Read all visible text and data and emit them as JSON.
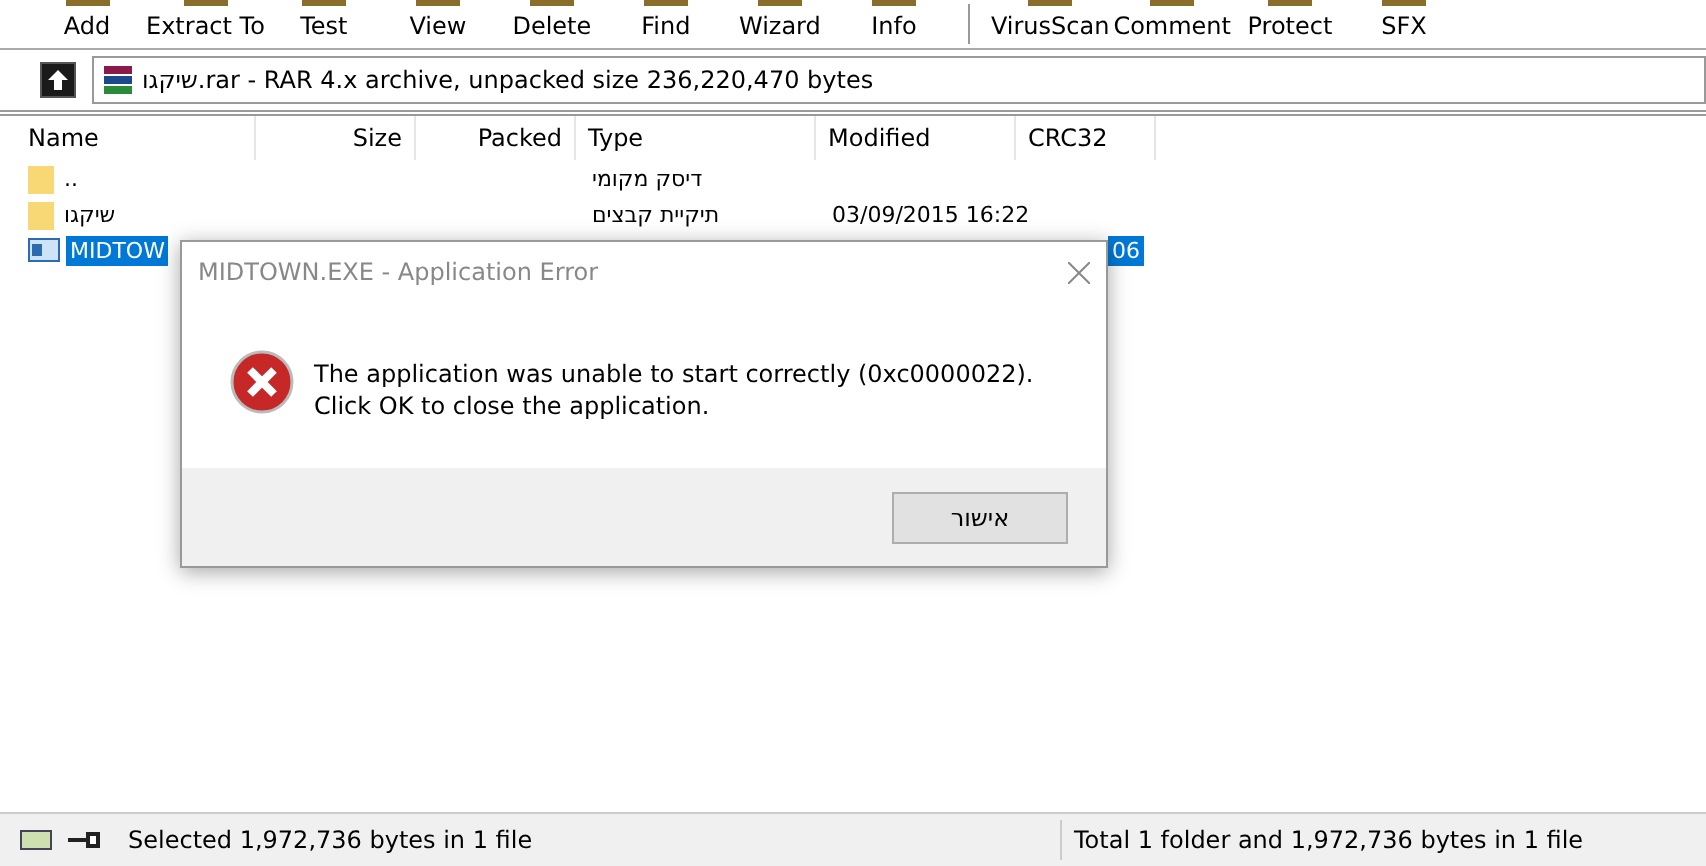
{
  "toolbar": {
    "buttons": [
      {
        "label": "Add"
      },
      {
        "label": "Extract To"
      },
      {
        "label": "Test"
      },
      {
        "label": "View"
      },
      {
        "label": "Delete"
      },
      {
        "label": "Find"
      },
      {
        "label": "Wizard"
      },
      {
        "label": "Info"
      },
      {
        "label": "VirusScan",
        "separator_before": true
      },
      {
        "label": "Comment"
      },
      {
        "label": "Protect"
      },
      {
        "label": "SFX"
      }
    ]
  },
  "address": {
    "text": "שיקגו.rar - RAR 4.x archive, unpacked size 236,220,470 bytes"
  },
  "table": {
    "columns": [
      "Name",
      "Size",
      "Packed",
      "Type",
      "Modified",
      "CRC32"
    ],
    "rows": [
      {
        "kind": "folder",
        "name": "..",
        "size": "",
        "packed": "",
        "type": "דיסק מקומי",
        "modified": "",
        "crc": "",
        "selected": false
      },
      {
        "kind": "folder",
        "name": "שיקגו",
        "size": "",
        "packed": "",
        "type": "תיקיית קבצים",
        "modified": "03/09/2015 16:22",
        "crc": "",
        "selected": false
      },
      {
        "kind": "file",
        "name": "MIDTOW",
        "size": "",
        "packed": "",
        "type": "",
        "modified": "",
        "crc": "06",
        "selected": true
      }
    ]
  },
  "dialog": {
    "title": "MIDTOWN.EXE - Application Error",
    "message": "The application was unable to start correctly (0xc0000022). Click OK to close the application.",
    "button": "אישור"
  },
  "status_bar": {
    "left": "Selected 1,972,736 bytes in 1 file",
    "right": "Total 1 folder and 1,972,736 bytes in 1 file"
  }
}
